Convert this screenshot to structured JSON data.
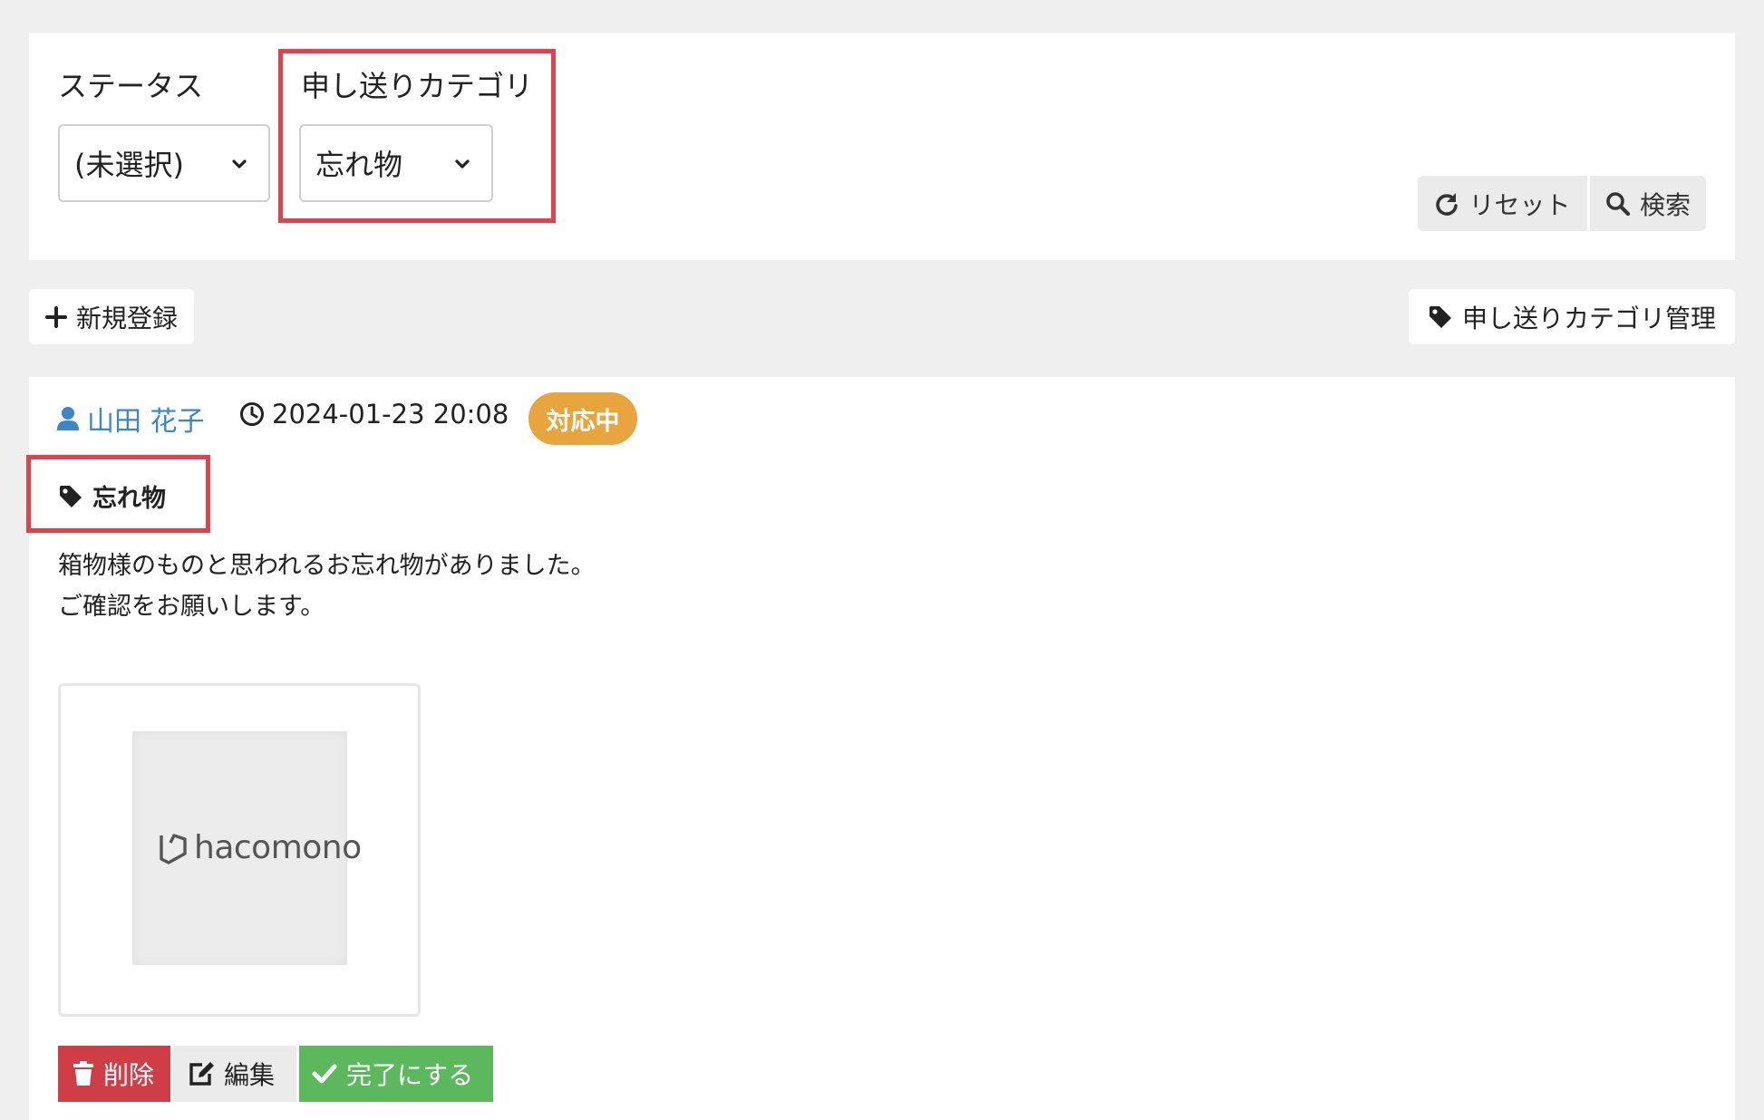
{
  "filters": {
    "status": {
      "label": "ステータス",
      "selected": "(未選択)"
    },
    "category": {
      "label": "申し送りカテゴリ",
      "selected": "忘れ物"
    },
    "reset_label": "リセット",
    "search_label": "検索"
  },
  "toolbar": {
    "new_label": "新規登録",
    "manage_categories_label": "申し送りカテゴリ管理"
  },
  "entry": {
    "author": "山田 花子",
    "timestamp": "2024-01-23 20:08",
    "status_badge": "対応中",
    "category": "忘れ物",
    "body_lines": [
      "箱物様のものと思われるお忘れ物がありました。",
      "ご確認をお願いします。"
    ],
    "attachment_logo_text": "hacomono",
    "actions": {
      "delete_label": "削除",
      "edit_label": "編集",
      "complete_label": "完了にする"
    }
  },
  "colors": {
    "highlight": "#e0414a",
    "author_link": "#3a86c8",
    "status_badge": "#e8a43d",
    "delete": "#cf3e46",
    "complete": "#5cb85c"
  },
  "icons": [
    "chevron-down-icon",
    "reset-icon",
    "search-icon",
    "plus-icon",
    "tag-icon",
    "user-icon",
    "clock-icon",
    "trash-icon",
    "edit-icon",
    "check-icon",
    "hacomono-logo-icon"
  ]
}
